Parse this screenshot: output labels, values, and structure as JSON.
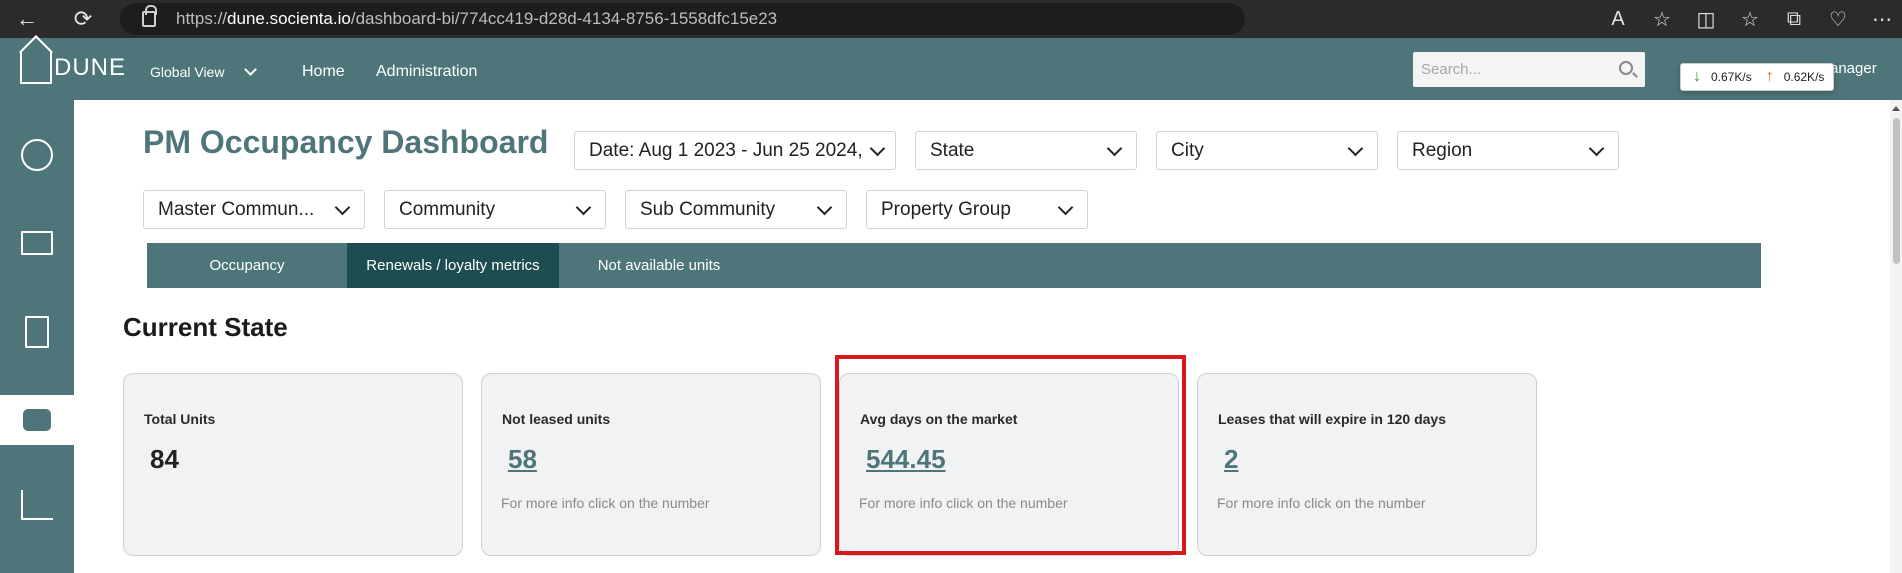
{
  "browser": {
    "url_prefix": "https://",
    "url_host": "dune.socienta.io",
    "url_path": "/dashboard-bi/774cc419-d28d-4134-8756-1558dfc15e23"
  },
  "header": {
    "logo_text": "DUNE",
    "nav": {
      "global_view": "Global View",
      "home": "Home",
      "administration": "Administration"
    },
    "search_placeholder": "Search...",
    "user_label": "anager",
    "speed": {
      "download": "0.67K/s",
      "upload": "0.62K/s"
    }
  },
  "page": {
    "title": "PM Occupancy Dashboard",
    "filters": {
      "date": "Date: Aug 1 2023 - Jun 25 2024,",
      "state": "State",
      "city": "City",
      "region": "Region",
      "master_community": "Master Commun...",
      "community": "Community",
      "sub_community": "Sub Community",
      "property_group": "Property Group"
    },
    "tabs": {
      "occupancy": "Occupancy",
      "renewals": "Renewals / loyalty metrics",
      "not_available": "Not available units"
    },
    "section_title": "Current State",
    "cards": [
      {
        "label": "Total Units",
        "value": "84",
        "note": ""
      },
      {
        "label": "Not leased units",
        "value": "58",
        "note": "For more info click on the number"
      },
      {
        "label": "Avg days on the market",
        "value": "544.45",
        "note": "For more info click on the number"
      },
      {
        "label": "Leases that will expire in 120 days",
        "value": "2",
        "note": "For more info click on the number"
      }
    ]
  },
  "colors": {
    "brand": "#4e767a",
    "active_tab": "#1d4d50",
    "highlight": "#d7191c"
  }
}
